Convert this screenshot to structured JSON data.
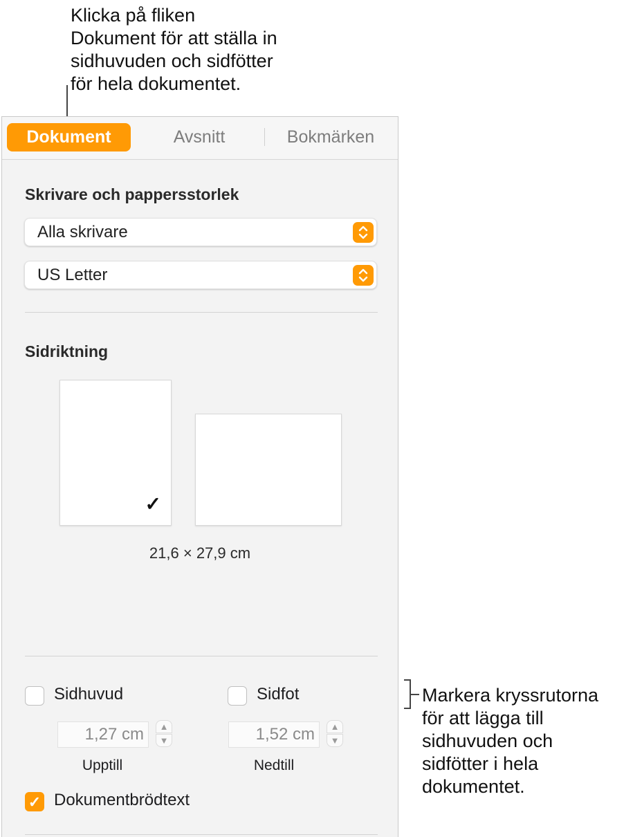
{
  "callouts": {
    "top": "Klicka på fliken\nDokument för att ställa in\nsidhuvuden och sidfötter\nför hela dokumentet.",
    "right": "Markera kryssrutorna\nför att lägga till\nsidhuvuden och\nsidfötter i hela\ndokumentet."
  },
  "tabs": [
    {
      "label": "Dokument",
      "active": true
    },
    {
      "label": "Avsnitt",
      "active": false
    },
    {
      "label": "Bokmärken",
      "active": false
    }
  ],
  "printer_section": {
    "title": "Skrivare och pappersstorlek",
    "printer_value": "Alla skrivare",
    "paper_value": "US Letter"
  },
  "orientation_section": {
    "title": "Sidriktning",
    "selected": "portrait",
    "checkmark": "✓",
    "page_size": "21,6 × 27,9 cm"
  },
  "header_footer": {
    "header_label": "Sidhuvud",
    "header_checked": false,
    "footer_label": "Sidfot",
    "footer_checked": false,
    "top_value": "1,27 cm",
    "top_caption": "Upptill",
    "bottom_value": "1,52 cm",
    "bottom_caption": "Nedtill",
    "body_label": "Dokumentbrödtext",
    "body_checked": true
  },
  "colors": {
    "accent": "#ff9a05"
  }
}
